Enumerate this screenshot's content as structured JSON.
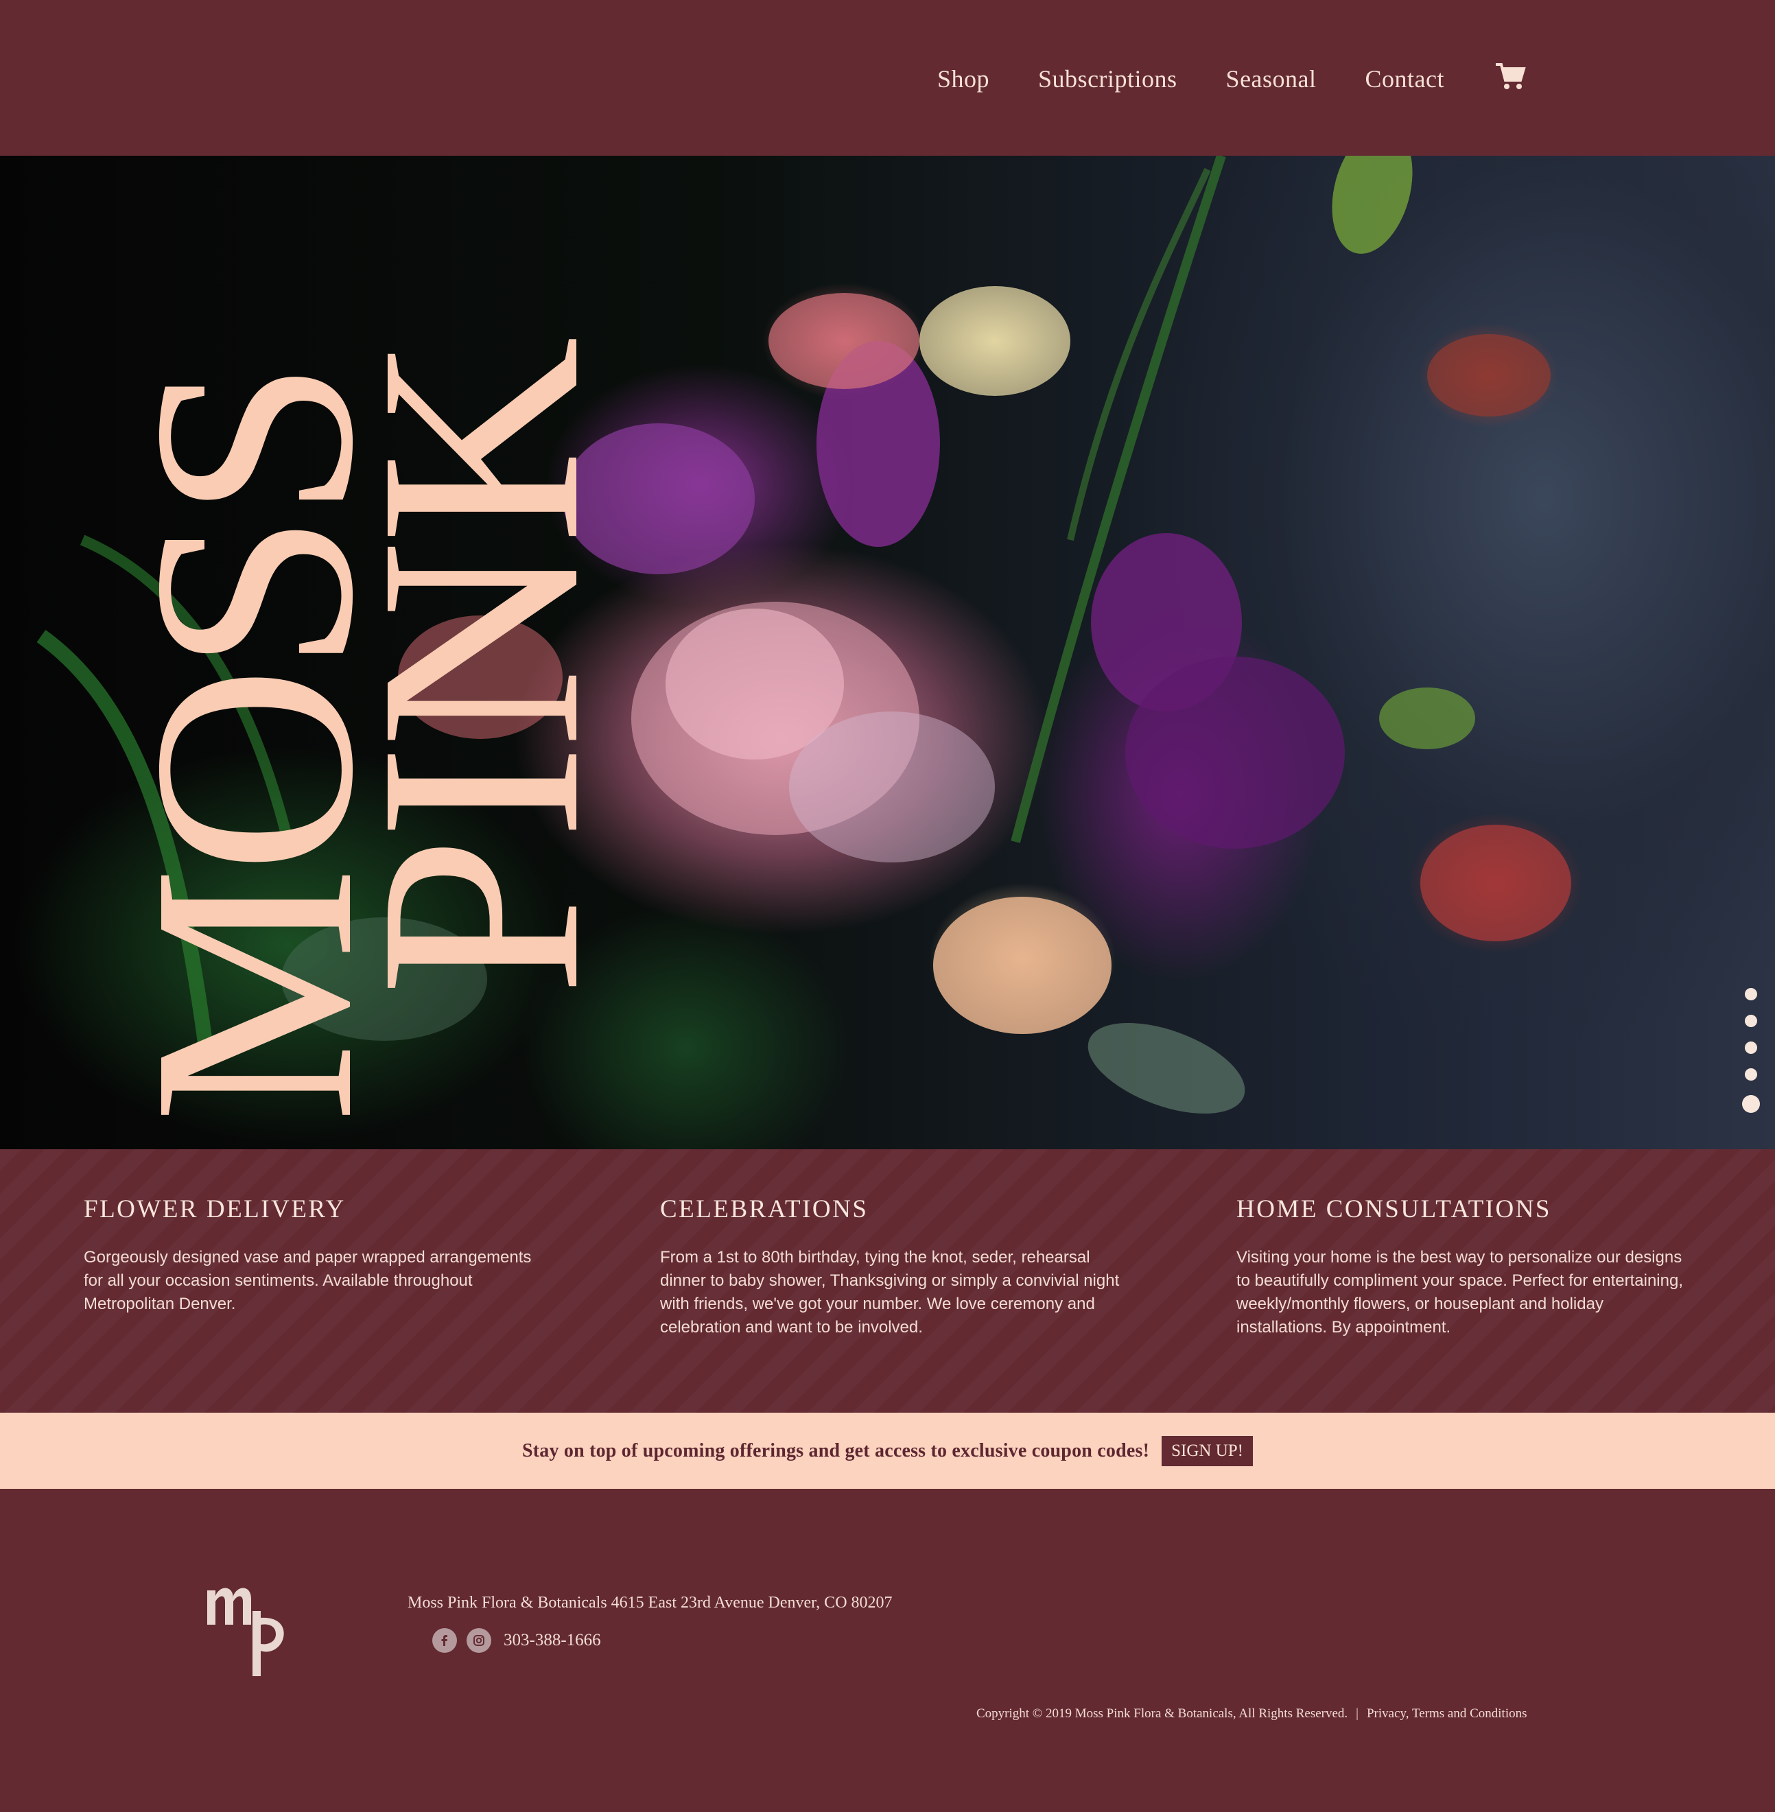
{
  "nav": {
    "items": [
      {
        "label": "Shop"
      },
      {
        "label": "Subscriptions"
      },
      {
        "label": "Seasonal"
      },
      {
        "label": "Contact"
      }
    ],
    "cart_icon": "shopping-cart-icon"
  },
  "hero": {
    "wordmark_line1": "MOSS",
    "wordmark_line2": "PINK",
    "slide_count": 5,
    "active_slide": 5
  },
  "services": [
    {
      "title": "FLOWER DELIVERY",
      "body": "Gorgeously designed vase and paper wrapped arrangements for all your occasion sentiments. Available throughout Metropolitan Denver."
    },
    {
      "title": "CELEBRATIONS",
      "body": "From a 1st to 80th birthday, tying the knot, seder, rehearsal dinner to baby shower, Thanksgiving or simply a convivial night with friends, we've got your number. We love ceremony and celebration and want to be involved."
    },
    {
      "title": "HOME CONSULTATIONS",
      "body": "Visiting your home is the best way to personalize our designs to beautifully compliment your space. Perfect for entertaining, weekly/monthly flowers, or houseplant and holiday installations. By appointment."
    }
  ],
  "signup": {
    "message": "Stay on top of upcoming offerings and get access to exclusive coupon codes!",
    "button_label": "SIGN UP!"
  },
  "footer": {
    "logo_icon": "mp-monogram-logo",
    "address": "Moss Pink Flora & Botanicals 4615 East 23rd Avenue Denver, CO 80207",
    "social_icons": [
      "facebook-icon",
      "instagram-icon"
    ],
    "phone": "303-388-1666",
    "copyright": "Copyright © 2019 Moss Pink Flora & Botanicals, All Rights Reserved.",
    "separator": "|",
    "legal_link": "Privacy, Terms and Conditions"
  },
  "colors": {
    "burgundy": "#632a32",
    "blush": "#fbd3bf",
    "wordmark": "#f9ccb3",
    "text_light": "#f3dcd2"
  }
}
